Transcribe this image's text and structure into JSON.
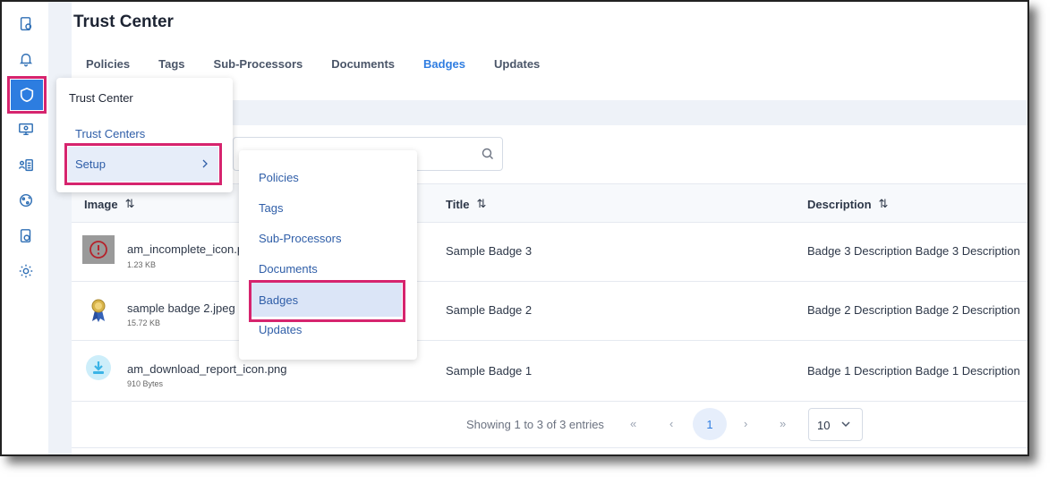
{
  "page": {
    "title": "Trust Center"
  },
  "tabs": [
    "Policies",
    "Tags",
    "Sub-Processors",
    "Documents",
    "Badges",
    "Updates"
  ],
  "active_tab": "Badges",
  "sidebar": {
    "icons": [
      "dashboard-icon",
      "bell-icon",
      "shield-icon",
      "monitor-icon",
      "contacts-icon",
      "integrations-icon",
      "document-icon",
      "settings-icon"
    ],
    "active": "shield-icon"
  },
  "table": {
    "headers": {
      "image": "Image",
      "title": "Title",
      "description": "Description"
    },
    "sort_glyph": "⇅",
    "rows": [
      {
        "file": "am_incomplete_icon.png",
        "size": "1.23 KB",
        "title": "Sample Badge 3",
        "description": "Badge 3 Description Badge 3 Description"
      },
      {
        "file": "sample badge 2.jpeg",
        "size": "15.72 KB",
        "title": "Sample Badge 2",
        "description": "Badge 2 Description Badge 2 Description"
      },
      {
        "file": "am_download_report_icon.png",
        "size": "910 Bytes",
        "title": "Sample Badge 1",
        "description": "Badge 1 Description Badge 1 Description"
      }
    ]
  },
  "pagination": {
    "summary": "Showing 1 to 3 of 3 entries",
    "first": "«",
    "prev": "‹",
    "current": "1",
    "next": "›",
    "last": "»",
    "page_size": "10"
  },
  "menu": {
    "title": "Trust Center",
    "items": [
      "Trust Centers",
      "Setup"
    ],
    "submenu": [
      "Policies",
      "Tags",
      "Sub-Processors",
      "Documents",
      "Badges",
      "Updates"
    ],
    "highlighted": "Badges"
  },
  "colors": {
    "accent": "#2f7de1",
    "highlight": "#d6246e",
    "link": "#2f5ea8"
  }
}
